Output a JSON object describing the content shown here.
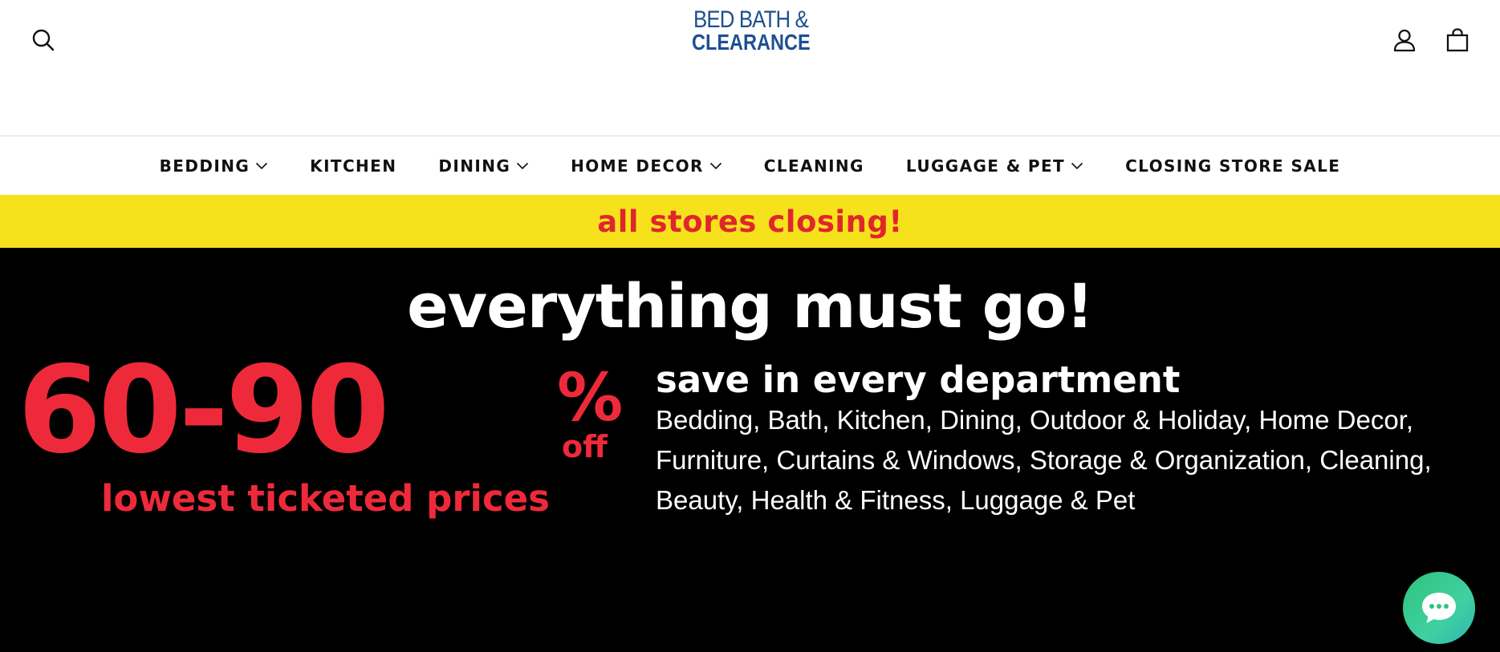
{
  "header": {
    "logo": {
      "line1": "BED BATH &",
      "line2": "CLEARANCE"
    },
    "icons": {
      "search": "search-icon",
      "account": "account-icon",
      "cart": "cart-icon"
    }
  },
  "nav": {
    "items": [
      {
        "label": "BEDDING",
        "has_dropdown": true
      },
      {
        "label": "KITCHEN",
        "has_dropdown": false
      },
      {
        "label": "DINING",
        "has_dropdown": true
      },
      {
        "label": "HOME DECOR",
        "has_dropdown": true
      },
      {
        "label": "CLEANING",
        "has_dropdown": false
      },
      {
        "label": "LUGGAGE & PET",
        "has_dropdown": true
      },
      {
        "label": "CLOSING STORE SALE",
        "has_dropdown": false
      }
    ]
  },
  "promo_strip": {
    "text": "all stores closing!"
  },
  "hero": {
    "headline": "everything must go!",
    "discount": "60-90",
    "percent_sign": "%",
    "off": "off",
    "subtext": "lowest ticketed prices",
    "save_heading": "save in every department",
    "departments": "Bedding, Bath, Kitchen, Dining, Outdoor & Holiday, Home Decor, Furniture, Curtains & Windows, Storage & Organization, Cleaning, Beauty, Health & Fitness, Luggage & Pet"
  },
  "chat": {
    "icon": "chat-icon"
  },
  "colors": {
    "brand_blue": "#1e4f91",
    "promo_yellow": "#f6e21c",
    "promo_red": "#e0262d",
    "hero_black": "#000000",
    "discount_red": "#ee2a3a",
    "chat_green": "#2ec27e"
  }
}
